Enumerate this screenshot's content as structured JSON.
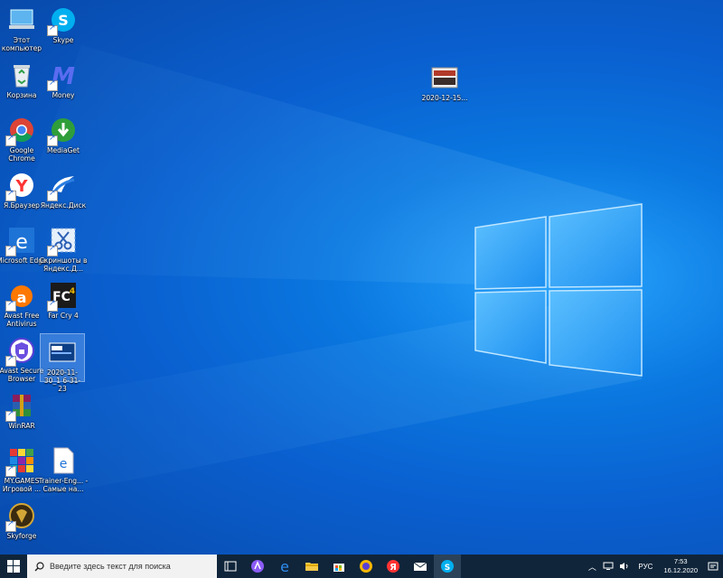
{
  "desktop": {
    "icons": [
      {
        "label": "Этот компьютер"
      },
      {
        "label": "Skype"
      },
      {
        "label": "Корзина"
      },
      {
        "label": "Money"
      },
      {
        "label": "Google Chrome"
      },
      {
        "label": "MediaGet"
      },
      {
        "label": "Я.Браузер"
      },
      {
        "label": "Яндекс.Диск"
      },
      {
        "label": "Microsoft Edge"
      },
      {
        "label": "Скриншоты в Яндекс.Д..."
      },
      {
        "label": "Avast Free Antivirus"
      },
      {
        "label": "Far Cry 4"
      },
      {
        "label": "Avast Secure Browser"
      },
      {
        "label": "2020-11-30_1 6-31-23"
      },
      {
        "label": "WinRAR"
      },
      {
        "label": "MY.GAMES Игровой ..."
      },
      {
        "label": "Trainer-Eng... - Самые на..."
      },
      {
        "label": "Skyforge"
      },
      {
        "label": "2020-12-15..."
      }
    ]
  },
  "taskbar": {
    "search_placeholder": "Введите здесь текст для поиска",
    "apps": [
      "task-view",
      "alice",
      "edge",
      "file-explorer",
      "store",
      "yandex-browser-alt",
      "yandex-browser",
      "mail",
      "skype"
    ],
    "language": "РУС",
    "time": "7:53",
    "date": "16.12.2020"
  },
  "colors": {
    "wallpaper": "#0a6fd6",
    "taskbar": "#10253a",
    "search_bg": "#f2f2f2"
  }
}
